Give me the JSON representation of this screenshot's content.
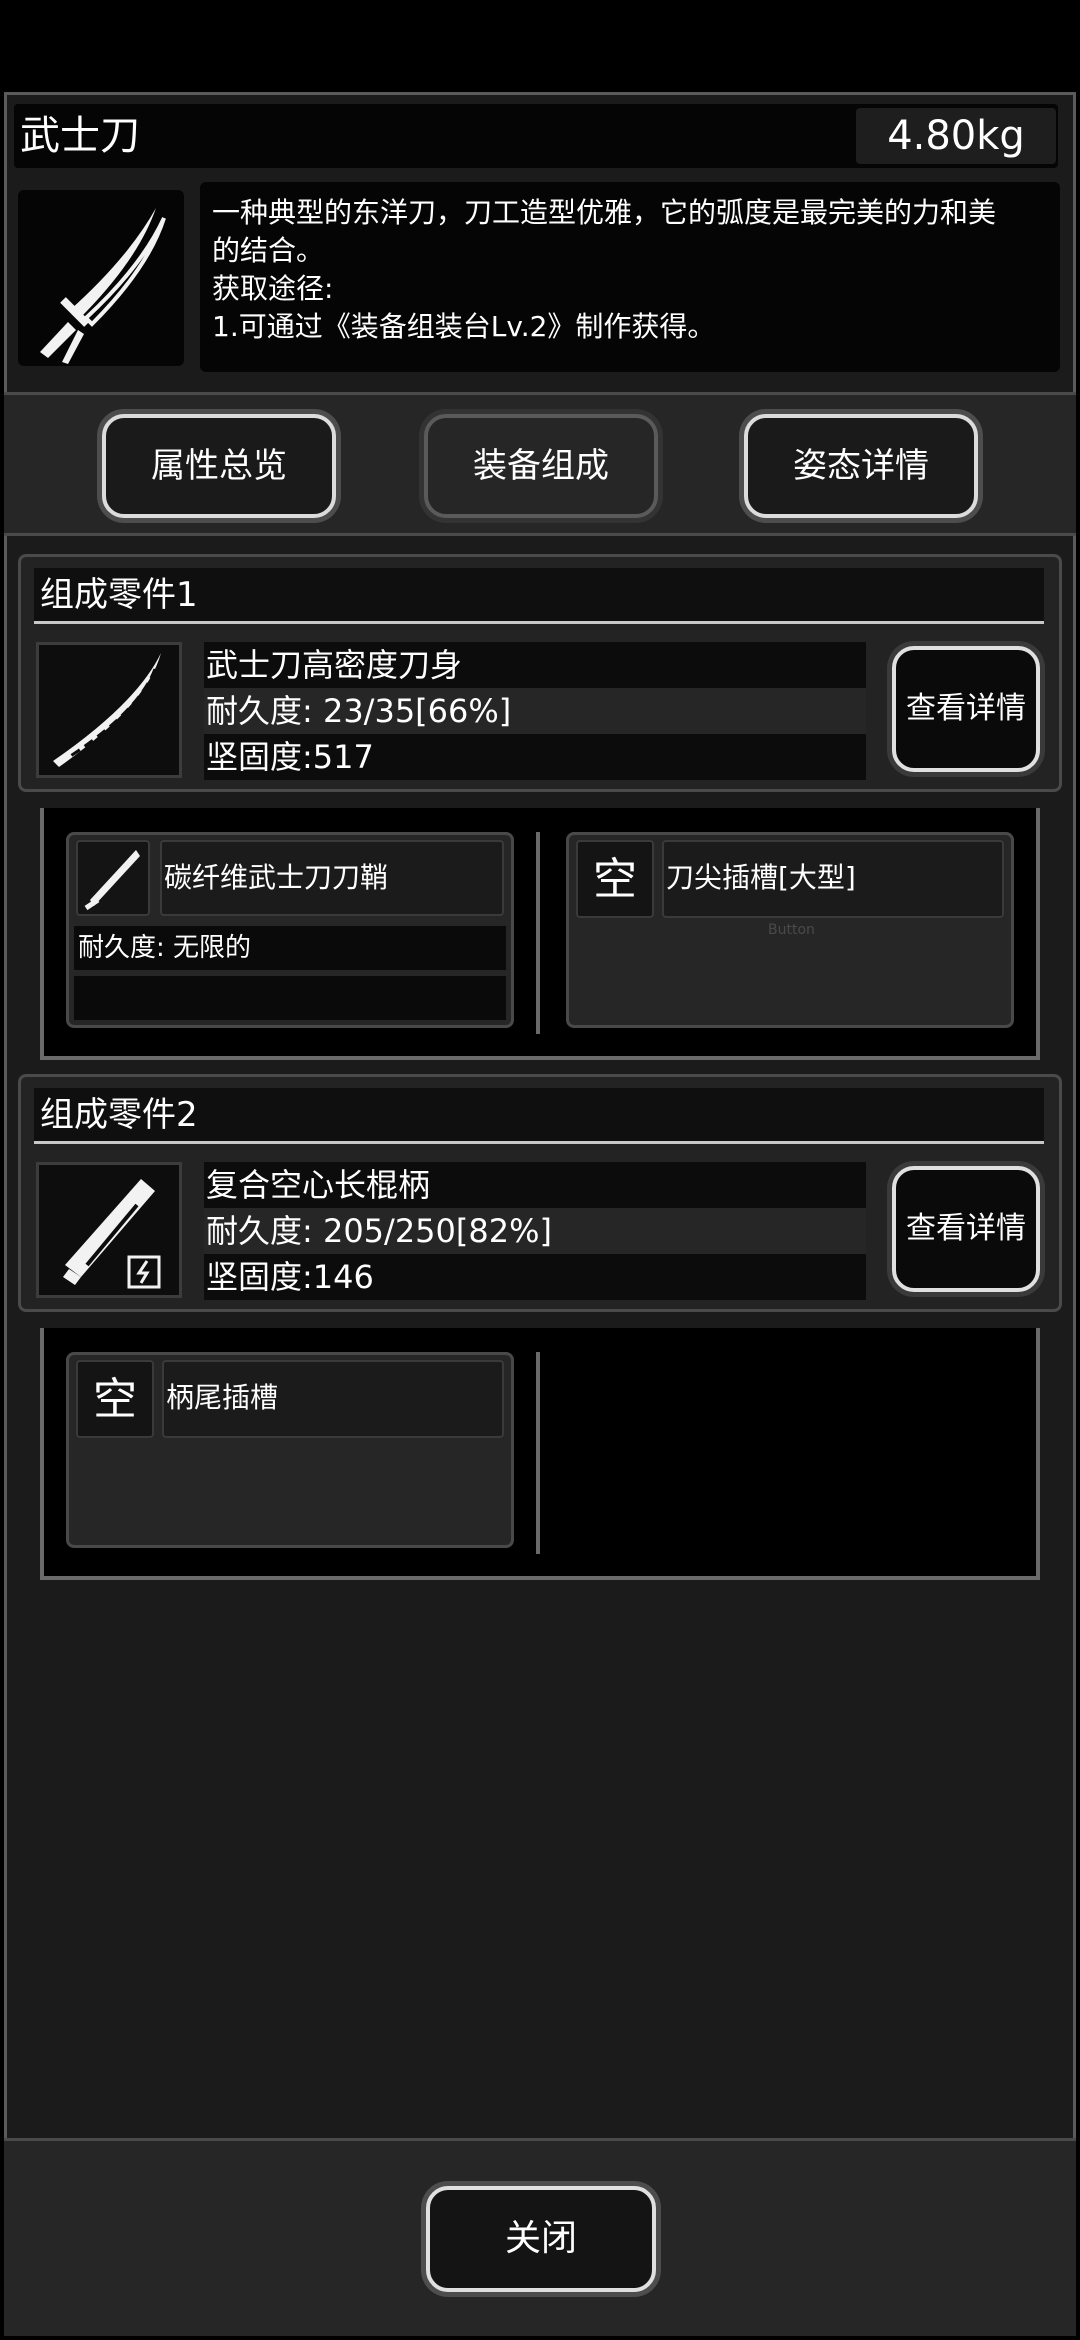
{
  "item": {
    "name": "武士刀",
    "weight": "4.80kg",
    "description": [
      "一种典型的东洋刀，刀工造型优雅，它的弧度是最完美的力和美",
      "的结合。",
      "获取途径:",
      "1.可通过《装备组装台Lv.2》制作获得。"
    ],
    "icon": "katana-icon"
  },
  "tabs": [
    {
      "label": "属性总览",
      "active": false
    },
    {
      "label": "装备组成",
      "active": true
    },
    {
      "label": "姿态详情",
      "active": false
    }
  ],
  "components": [
    {
      "title": "组成零件1",
      "part_name": "武士刀高密度刀身",
      "durability": "耐久度: 23/35[66%]",
      "solidity": "坚固度:517",
      "detail_label": "查看详情",
      "icon": "katana-blade-icon",
      "slots": [
        {
          "icon": "scabbard-icon",
          "name": "碳纤维武士刀刀鞘",
          "info": "耐久度: 无限的"
        },
        {
          "icon_text": "空",
          "name": "刀尖插槽[大型]",
          "ghost": "Button"
        }
      ]
    },
    {
      "title": "组成零件2",
      "part_name": "复合空心长棍柄",
      "durability": "耐久度: 205/250[82%]",
      "solidity": "坚固度:146",
      "detail_label": "查看详情",
      "icon": "hollow-handle-icon",
      "slots": [
        {
          "icon_text": "空",
          "name": "柄尾插槽"
        }
      ]
    }
  ],
  "footer": {
    "close_label": "关闭"
  }
}
